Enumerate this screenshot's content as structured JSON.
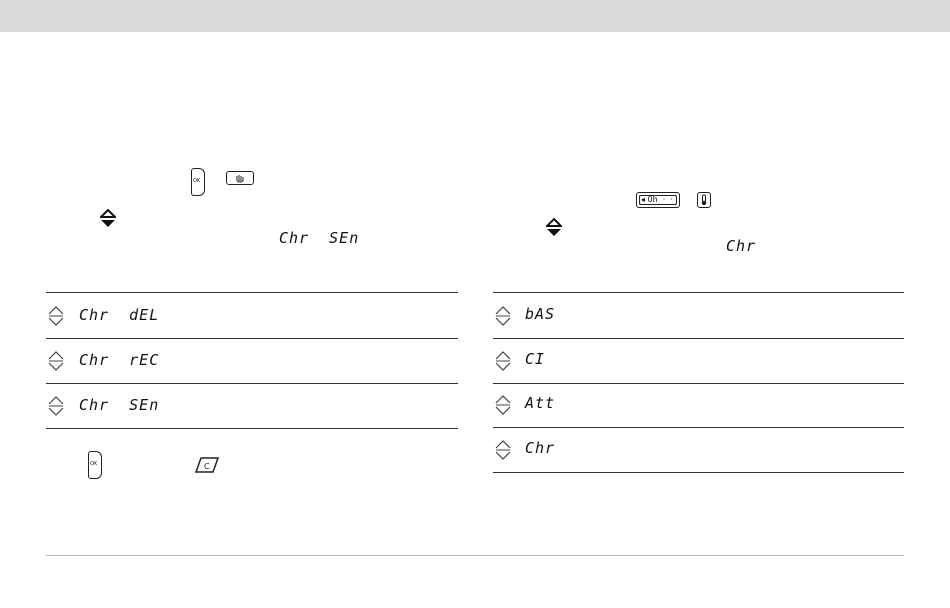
{
  "left_panel": {
    "display_label": "Chr  SEn",
    "rows": [
      {
        "label": "Chr  dEL"
      },
      {
        "label": "Chr  rEC"
      },
      {
        "label": "Chr  SEn"
      }
    ],
    "ok_text": "OK",
    "c_text": "C"
  },
  "right_panel": {
    "display_label": "Chr",
    "scale_text": "◂ 0h  ·  ·",
    "rows": [
      {
        "label": "bAS"
      },
      {
        "label": "CI"
      },
      {
        "label": "Att"
      },
      {
        "label": "Chr"
      }
    ]
  }
}
